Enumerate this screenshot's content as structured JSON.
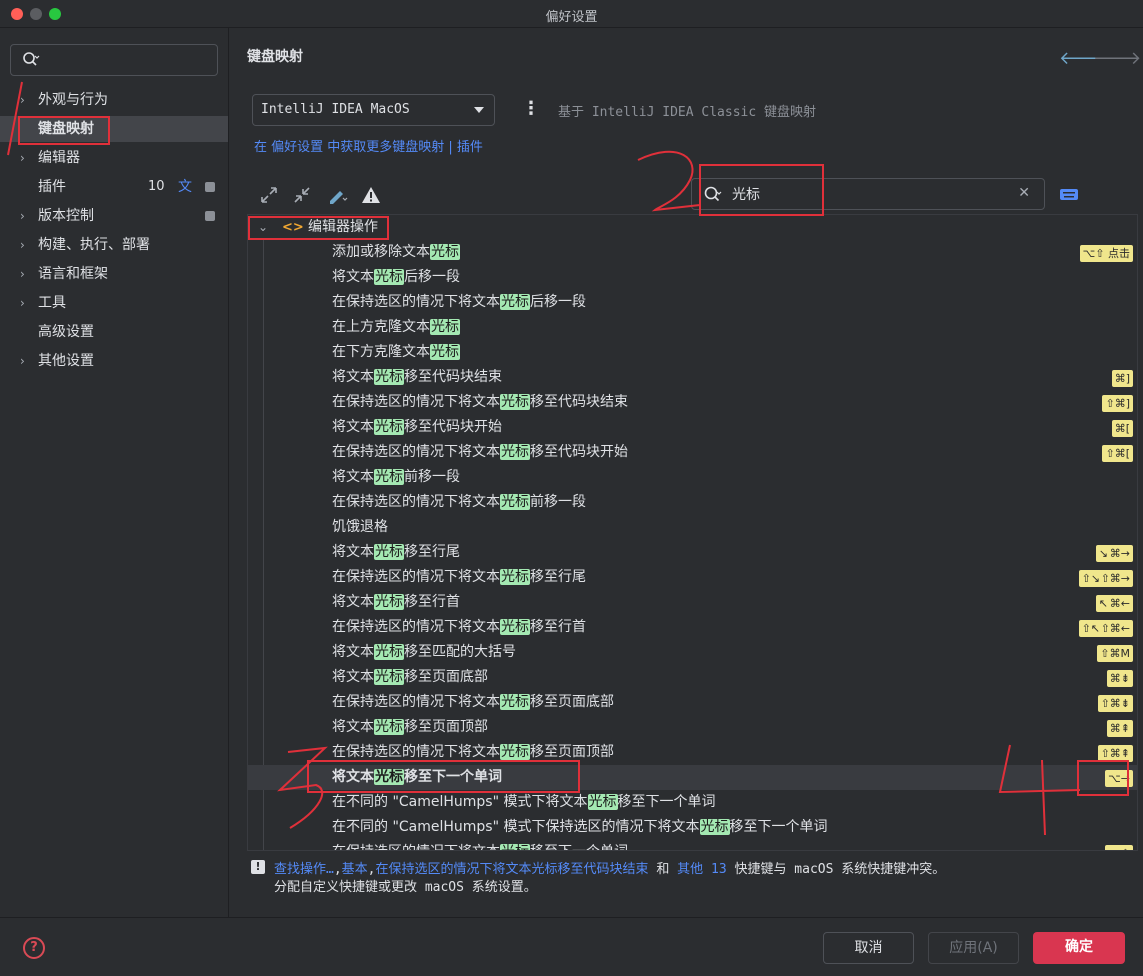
{
  "window": {
    "title": "偏好设置"
  },
  "sidebar": {
    "search_placeholder": "",
    "items": [
      {
        "label": "外观与行为",
        "arrow": "›"
      },
      {
        "label": "键盘映射",
        "arrow": ""
      },
      {
        "label": "编辑器",
        "arrow": "›"
      },
      {
        "label": "插件",
        "arrow": "",
        "count": "10"
      },
      {
        "label": "版本控制",
        "arrow": "›"
      },
      {
        "label": "构建、执行、部署",
        "arrow": "›"
      },
      {
        "label": "语言和框架",
        "arrow": "›"
      },
      {
        "label": "工具",
        "arrow": "›"
      },
      {
        "label": "高级设置",
        "arrow": ""
      },
      {
        "label": "其他设置",
        "arrow": "›"
      }
    ]
  },
  "main": {
    "title": "键盘映射",
    "keymap": "IntelliJ IDEA MacOS",
    "based_on": "基于 IntelliJ IDEA Classic 键盘映射",
    "links": "在 偏好设置 中获取更多键盘映射 | 插件",
    "search_value": "光标",
    "group_label": "编辑器操作"
  },
  "actions": [
    {
      "pre": "添加或移除文本",
      "hl": "光标",
      "post": "",
      "sc": [
        "⌥⇧ 点击"
      ]
    },
    {
      "pre": "将文本",
      "hl": "光标",
      "post": "后移一段",
      "sc": []
    },
    {
      "pre": "在保持选区的情况下将文本",
      "hl": "光标",
      "post": "后移一段",
      "sc": []
    },
    {
      "pre": "在上方克隆文本",
      "hl": "光标",
      "post": "",
      "sc": []
    },
    {
      "pre": "在下方克隆文本",
      "hl": "光标",
      "post": "",
      "sc": []
    },
    {
      "pre": "将文本",
      "hl": "光标",
      "post": "移至代码块结束",
      "sc": [
        "⌘]"
      ]
    },
    {
      "pre": "在保持选区的情况下将文本",
      "hl": "光标",
      "post": "移至代码块结束",
      "sc": [
        "⇧⌘]"
      ]
    },
    {
      "pre": "将文本",
      "hl": "光标",
      "post": "移至代码块开始",
      "sc": [
        "⌘["
      ]
    },
    {
      "pre": "在保持选区的情况下将文本",
      "hl": "光标",
      "post": "移至代码块开始",
      "sc": [
        "⇧⌘["
      ]
    },
    {
      "pre": "将文本",
      "hl": "光标",
      "post": "前移一段",
      "sc": []
    },
    {
      "pre": "在保持选区的情况下将文本",
      "hl": "光标",
      "post": "前移一段",
      "sc": []
    },
    {
      "pre": "饥饿退格",
      "hl": "",
      "post": "",
      "sc": []
    },
    {
      "pre": "将文本",
      "hl": "光标",
      "post": "移至行尾",
      "sc": [
        "↘",
        "⌘→"
      ]
    },
    {
      "pre": "在保持选区的情况下将文本",
      "hl": "光标",
      "post": "移至行尾",
      "sc": [
        "⇧↘",
        "⇧⌘→"
      ]
    },
    {
      "pre": "将文本",
      "hl": "光标",
      "post": "移至行首",
      "sc": [
        "↖",
        "⌘←"
      ]
    },
    {
      "pre": "在保持选区的情况下将文本",
      "hl": "光标",
      "post": "移至行首",
      "sc": [
        "⇧↖",
        "⇧⌘←"
      ]
    },
    {
      "pre": "将文本",
      "hl": "光标",
      "post": "移至匹配的大括号",
      "sc": [
        "⇧⌘M"
      ]
    },
    {
      "pre": "将文本",
      "hl": "光标",
      "post": "移至页面底部",
      "sc": [
        "⌘⇟"
      ]
    },
    {
      "pre": "在保持选区的情况下将文本",
      "hl": "光标",
      "post": "移至页面底部",
      "sc": [
        "⇧⌘⇟"
      ]
    },
    {
      "pre": "将文本",
      "hl": "光标",
      "post": "移至页面顶部",
      "sc": [
        "⌘⇞"
      ]
    },
    {
      "pre": "在保持选区的情况下将文本",
      "hl": "光标",
      "post": "移至页面顶部",
      "sc": [
        "⇧⌘⇞"
      ]
    },
    {
      "pre": "将文本",
      "hl": "光标",
      "post": "移至下一个单词",
      "sc": [
        "⌥→"
      ],
      "selected": true
    },
    {
      "pre": "在不同的 \"CamelHumps\" 模式下将文本",
      "hl": "光标",
      "post": "移至下一个单词",
      "sc": []
    },
    {
      "pre": "在不同的 \"CamelHumps\" 模式下保持选区的情况下将文本",
      "hl": "光标",
      "post": "移至下一个单词",
      "sc": []
    },
    {
      "pre": "在保持选区的情况下将文本",
      "hl": "光标",
      "post": "移至下一个单词",
      "sc": [
        "⌥⇧"
      ]
    }
  ],
  "warning": {
    "link_find": "查找操作…",
    "sep1": ",",
    "link_basic": "基本",
    "sep2": ",",
    "link_action": "在保持选区的情况下将文本光标移至代码块结束",
    "and": " 和 ",
    "link_other": "其他 13",
    "tail": " 快捷键与 macOS 系统快捷键冲突。",
    "line2": "分配自定义快捷键或更改 macOS 系统设置。"
  },
  "buttons": {
    "cancel": "取消",
    "apply": "应用(A)",
    "ok": "确定",
    "help": "?"
  },
  "annotations": [
    "1",
    "2",
    "3",
    "4"
  ],
  "colors": {
    "accent": "#548af7",
    "highlight": "#a4e8b2",
    "shortcut_bg": "#f0e68c",
    "ok_button": "#d93650",
    "annotation": "#e0303a"
  }
}
